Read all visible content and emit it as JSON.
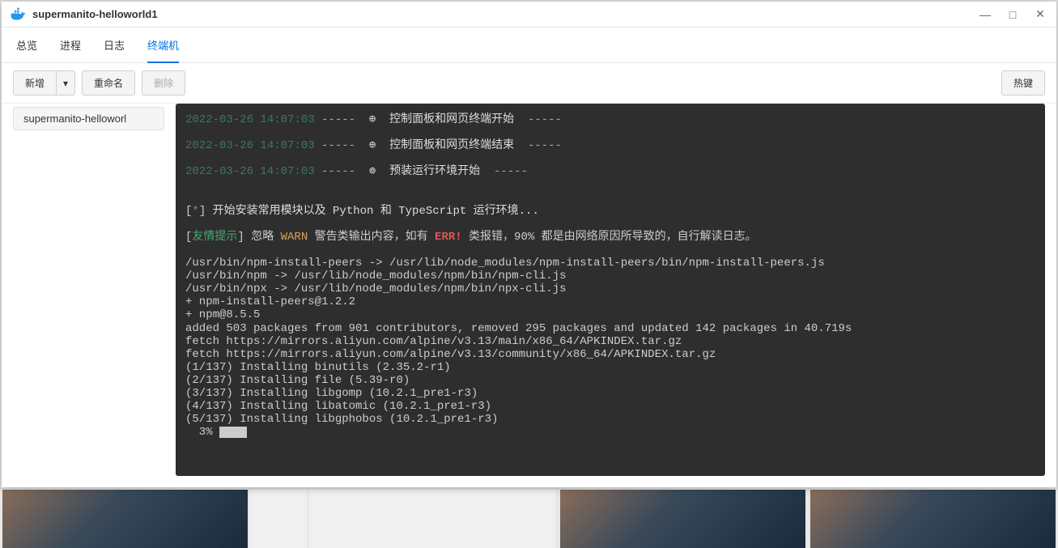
{
  "window": {
    "title": "supermanito-helloworld1",
    "controls": {
      "min": "—",
      "max": "□",
      "close": "✕"
    }
  },
  "tabs": [
    {
      "label": "总览",
      "active": false
    },
    {
      "label": "进程",
      "active": false
    },
    {
      "label": "日志",
      "active": false
    },
    {
      "label": "终端机",
      "active": true
    }
  ],
  "toolbar": {
    "new": "新增",
    "caret": "▾",
    "rename": "重命名",
    "delete": "删除",
    "hotkeys": "热键"
  },
  "sidebar": {
    "items": [
      {
        "label": "supermanito-helloworl"
      }
    ]
  },
  "terminal": {
    "lines": [
      {
        "type": "banner",
        "ts": "2022-03-26 14:07:03",
        "sym": "⊕",
        "msg": "控制面板和网页终端开始"
      },
      {
        "type": "blank"
      },
      {
        "type": "banner",
        "ts": "2022-03-26 14:07:03",
        "sym": "⊕",
        "msg": "控制面板和网页终端结束"
      },
      {
        "type": "blank"
      },
      {
        "type": "banner",
        "ts": "2022-03-26 14:07:03",
        "sym": "⊚",
        "msg": "预装运行环境开始"
      },
      {
        "type": "blank"
      },
      {
        "type": "blank"
      },
      {
        "type": "star",
        "text": "开始安装常用模块以及 Python 和 TypeScript 运行环境..."
      },
      {
        "type": "blank"
      },
      {
        "type": "tip",
        "tip": "友情提示",
        "pre": "] 忽略 ",
        "warn": "WARN",
        "mid": " 警告类输出内容，如有 ",
        "err": "ERR!",
        "post": " 类报错，90% 都是由网络原因所导致的，自行解读日志。"
      },
      {
        "type": "blank"
      },
      {
        "type": "plain",
        "text": "/usr/bin/npm-install-peers -> /usr/lib/node_modules/npm-install-peers/bin/npm-install-peers.js"
      },
      {
        "type": "plain",
        "text": "/usr/bin/npm -> /usr/lib/node_modules/npm/bin/npm-cli.js"
      },
      {
        "type": "plain",
        "text": "/usr/bin/npx -> /usr/lib/node_modules/npm/bin/npx-cli.js"
      },
      {
        "type": "plain",
        "text": "+ npm-install-peers@1.2.2"
      },
      {
        "type": "plain",
        "text": "+ npm@8.5.5"
      },
      {
        "type": "plain",
        "text": "added 503 packages from 901 contributors, removed 295 packages and updated 142 packages in 40.719s"
      },
      {
        "type": "plain",
        "text": "fetch https://mirrors.aliyun.com/alpine/v3.13/main/x86_64/APKINDEX.tar.gz"
      },
      {
        "type": "plain",
        "text": "fetch https://mirrors.aliyun.com/alpine/v3.13/community/x86_64/APKINDEX.tar.gz"
      },
      {
        "type": "plain",
        "text": "(1/137) Installing binutils (2.35.2-r1)"
      },
      {
        "type": "plain",
        "text": "(2/137) Installing file (5.39-r0)"
      },
      {
        "type": "plain",
        "text": "(3/137) Installing libgomp (10.2.1_pre1-r3)"
      },
      {
        "type": "plain",
        "text": "(4/137) Installing libatomic (10.2.1_pre1-r3)"
      },
      {
        "type": "plain",
        "text": "(5/137) Installing libgphobos (10.2.1_pre1-r3)"
      },
      {
        "type": "progress",
        "pct": "  3% "
      }
    ]
  }
}
